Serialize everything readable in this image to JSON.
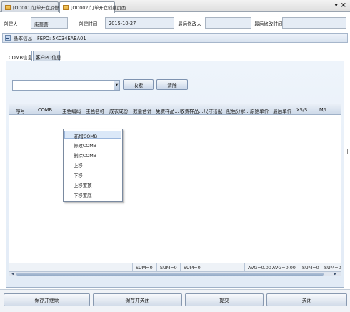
{
  "window_tabs": [
    {
      "label": "[OD001]订单开立及修改",
      "active": false
    },
    {
      "label": "[OD002]订单开立创建页面",
      "active": true
    }
  ],
  "window_close": "×",
  "header": {
    "creator_label": "创建人",
    "creator_value": "唐蕾蕾",
    "created_time_label": "创建时间",
    "created_time_value": "2015-10-27",
    "last_modifier_label": "最后修改人",
    "last_modifier_value": "",
    "last_modified_time_label": "最后修改时间",
    "last_modified_time_value": ""
  },
  "section": {
    "title": "基本信息__FEPO: 5KC34EABA01"
  },
  "sub_tabs": [
    {
      "label": "COMB信息",
      "active": true
    },
    {
      "label": "客户PO信息",
      "active": false
    }
  ],
  "filter": {
    "combo_value": "",
    "search_label": "收索",
    "clear_label": "清除"
  },
  "grid": {
    "columns": [
      "序号",
      "COMB",
      "主色编码",
      "主色名称",
      "成衣成份",
      "数量合计",
      "免费样品...",
      "收费样品...",
      "尺寸搭配",
      "配色分解...",
      "原始单价",
      "最后单价",
      "XS/S",
      "M/L"
    ],
    "rows": [],
    "summary": [
      "SUM=0",
      "SUM=0",
      "SUM=0",
      "AVG=0.00",
      "AVG=0.00",
      "SUM=0",
      "SUM=0"
    ]
  },
  "context_menu": {
    "items": [
      "新增COMB",
      "修改COMB",
      "删除COMB",
      "上移",
      "下移",
      "上移置顶",
      "下移置底"
    ],
    "highlighted_index": 0
  },
  "footer_buttons": [
    "保存并继续",
    "保存并关闭",
    "提交",
    "关闭"
  ],
  "colors": {
    "panel_bg": "#e2ebf6",
    "header_field_bg": "#e5ecf5",
    "menu_highlight": "#dbe8f8",
    "border": "#9fb1c8"
  }
}
